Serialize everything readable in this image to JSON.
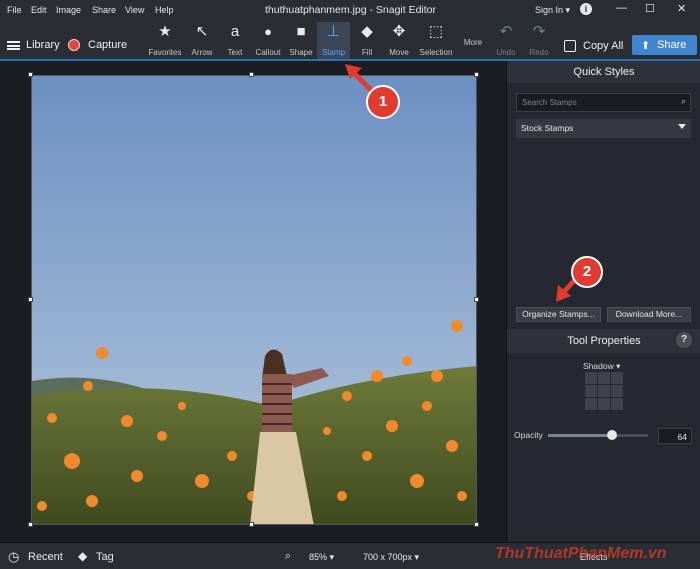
{
  "menubar": {
    "items": [
      "File",
      "Edit",
      "Image",
      "Share",
      "View",
      "Help"
    ],
    "title": "thuthuatphanmem.jpg - Snagit Editor",
    "signin": "Sign In ▾",
    "info": "i",
    "minimize": "—",
    "maximize": "☐",
    "close": "✕"
  },
  "toolbar": {
    "library": "Library",
    "capture": "Capture",
    "tools": [
      {
        "label": "Favorites",
        "icon": "★"
      },
      {
        "label": "Arrow",
        "icon": "↖"
      },
      {
        "label": "Text",
        "icon": "a"
      },
      {
        "label": "Callout",
        "icon": "💬"
      },
      {
        "label": "Shape",
        "icon": "■"
      },
      {
        "label": "Stamp",
        "icon": "⊥"
      },
      {
        "label": "Fill",
        "icon": "◆"
      },
      {
        "label": "Move",
        "icon": "✥"
      },
      {
        "label": "Selection",
        "icon": "⬚"
      },
      {
        "label": "More",
        "icon": ""
      },
      {
        "label": "Undo",
        "icon": "↶"
      },
      {
        "label": "Redo",
        "icon": "↷"
      }
    ],
    "copy_all": "Copy All",
    "share": "Share",
    "share_icon": "⬆"
  },
  "panel": {
    "quick_styles": "Quick Styles",
    "search_placeholder": "Search Stamps",
    "stock_select": "Stock Stamps",
    "organize_button": "Organize Stamps...",
    "download_button": "Download More...",
    "tool_properties": "Tool Properties",
    "help": "?",
    "shadow": "Shadow ▾",
    "opacity_label": "Opacity",
    "opacity_value": "64",
    "opacity_level": 0.64
  },
  "status": {
    "recent": "Recent",
    "tag": "Tag",
    "zoom": "85% ▾",
    "size": "700 x 700px ▾",
    "effects": "Effects"
  },
  "annotations": {
    "badge1": "1",
    "badge2": "2"
  },
  "watermark": "ThuThuatPhanMem.vn",
  "colors": {
    "accent": "#3f86cf",
    "active_tool": "#58a6ff",
    "badge": "#e03b30",
    "record": "#e2453c"
  }
}
